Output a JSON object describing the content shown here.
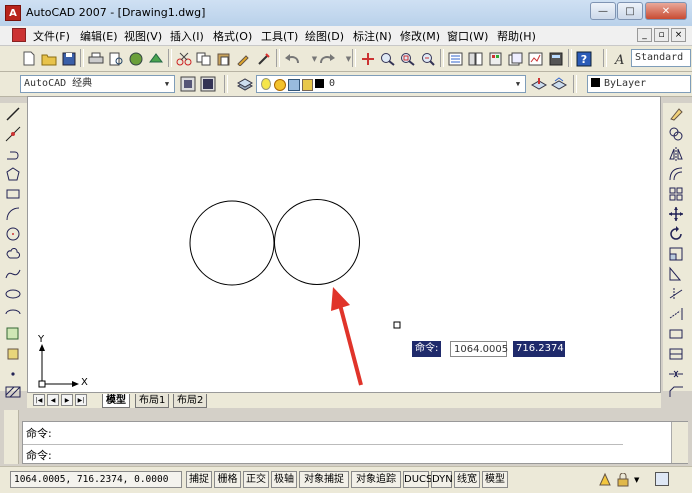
{
  "window": {
    "title": "AutoCAD 2007 - [Drawing1.dwg]",
    "app_icon_label": "A",
    "minimize": "—",
    "maximize": "□",
    "close": "✕"
  },
  "menu": {
    "items": [
      {
        "label": "文件(F)"
      },
      {
        "label": "编辑(E)"
      },
      {
        "label": "视图(V)"
      },
      {
        "label": "插入(I)"
      },
      {
        "label": "格式(O)"
      },
      {
        "label": "工具(T)"
      },
      {
        "label": "绘图(D)"
      },
      {
        "label": "标注(N)"
      },
      {
        "label": "修改(M)"
      },
      {
        "label": "窗口(W)"
      },
      {
        "label": "帮助(H)"
      }
    ],
    "doc_min": "_",
    "doc_restore": "▫",
    "doc_close": "×"
  },
  "toolbar": {
    "text_style": "Standard"
  },
  "workspace": {
    "current": "AutoCAD 经典"
  },
  "layers": {
    "current_layer": "0",
    "color_control": "ByLayer"
  },
  "drawing": {
    "tooltip_label": "命令:",
    "tooltip_x": "1064.0005",
    "tooltip_y": "716.2374",
    "ucs_x_label": "X",
    "ucs_y_label": "Y"
  },
  "tabs": [
    {
      "label": "模型",
      "active": true
    },
    {
      "label": "布局1",
      "active": false
    },
    {
      "label": "布局2",
      "active": false
    }
  ],
  "command": {
    "line1": "命令:",
    "line2": "命令:"
  },
  "status": {
    "coordinates": "1064.0005, 716.2374, 0.0000",
    "buttons": [
      "捕捉",
      "栅格",
      "正交",
      "极轴",
      "对象捕捉",
      "对象追踪",
      "DUCS",
      "DYN",
      "线宽",
      "模型"
    ]
  },
  "colors": {
    "titlebar": "#b9d1ea",
    "tooltip_bg": "#1f2a6b",
    "arrow": "#e0342a",
    "canvas": "#ffffff"
  }
}
